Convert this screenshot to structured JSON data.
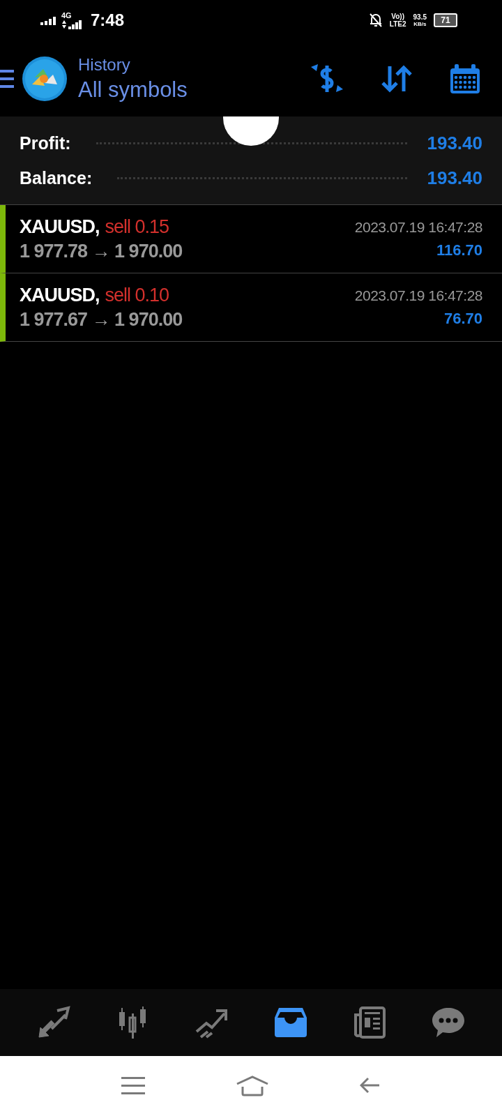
{
  "status_bar": {
    "network": "4G",
    "time": "7:48",
    "volte": "Vo))",
    "lte": "LTE2",
    "speed": "93.5",
    "speed_unit": "KB/s",
    "battery": "71"
  },
  "header": {
    "title": "History",
    "subtitle": "All symbols"
  },
  "summary": [
    {
      "label": "Profit:",
      "value": "193.40"
    },
    {
      "label": "Balance:",
      "value": "193.40"
    }
  ],
  "deals": [
    {
      "symbol": "XAUUSD,",
      "order": "sell 0.15",
      "prices": "1 977.78 → 1 970.00",
      "time": "2023.07.19 16:47:28",
      "profit": "116.70"
    },
    {
      "symbol": "XAUUSD,",
      "order": "sell 0.10",
      "prices": "1 977.67 → 1 970.00",
      "time": "2023.07.19 16:47:28",
      "profit": "76.70"
    }
  ],
  "bottom_nav": [
    {
      "kind": "quotes",
      "selected": false
    },
    {
      "kind": "chart",
      "selected": false
    },
    {
      "kind": "trade",
      "selected": false
    },
    {
      "kind": "history",
      "selected": true
    },
    {
      "kind": "news",
      "selected": false
    },
    {
      "kind": "chat",
      "selected": false
    }
  ],
  "system_nav": [
    {
      "kind": "menu"
    },
    {
      "kind": "home"
    },
    {
      "kind": "back"
    }
  ]
}
